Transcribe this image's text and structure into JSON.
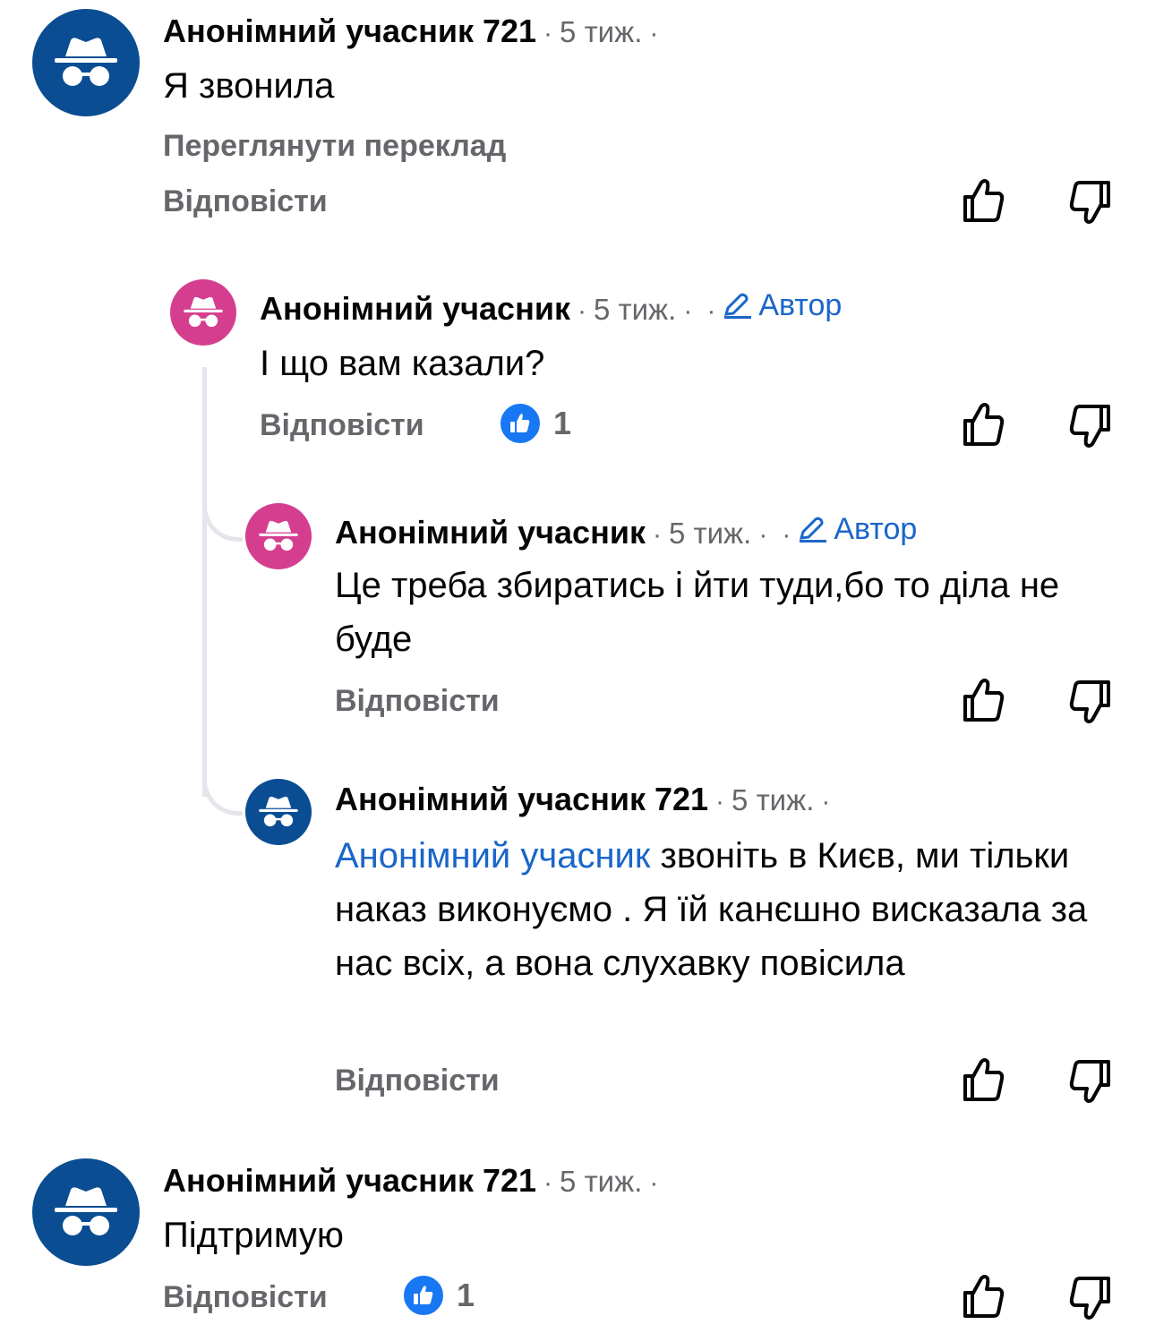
{
  "colors": {
    "avatar_blue": "#0a4d93",
    "avatar_pink": "#d53e8f",
    "link_blue": "#1a66c9",
    "like_blue": "#1877f2",
    "muted_gray": "#65676b"
  },
  "icons": {
    "avatar": "incognito-hat-glasses-icon",
    "like": "thumbs-up-outline-icon",
    "dislike": "thumbs-down-outline-icon",
    "author": "pencil-icon",
    "reaction": "like-reaction-icon"
  },
  "comments": [
    {
      "author": "Анонімний учасник 721",
      "time": "5 тиж.",
      "dot": "·",
      "text": "Я звонила",
      "translate": "Переглянути переклад",
      "reply": "Відповісти"
    },
    {
      "author": "Анонімний учасник",
      "time": "5 тиж.",
      "dot": "·",
      "badge": "Автор",
      "text": "І що вам казали?",
      "reply": "Відповісти",
      "reaction_count": "1"
    },
    {
      "author": "Анонімний учасник",
      "time": "5 тиж.",
      "dot": "·",
      "badge": "Автор",
      "text": "Це треба збиратись і йти туди,бо то діла не буде",
      "reply": "Відповісти"
    },
    {
      "author": "Анонімний учасник 721",
      "time": "5 тиж.",
      "dot": "·",
      "mention": "Анонімний учасник",
      "text": " звоніть в Києв, ми тільки наказ виконуємо . Я їй канєшно висказала за нас всіх, а вона слухавку повісила",
      "reply": "Відповісти"
    },
    {
      "author": "Анонімний учасник 721",
      "time": "5 тиж.",
      "dot": "·",
      "text": "Підтримую",
      "reply": "Відповісти",
      "reaction_count": "1"
    }
  ]
}
